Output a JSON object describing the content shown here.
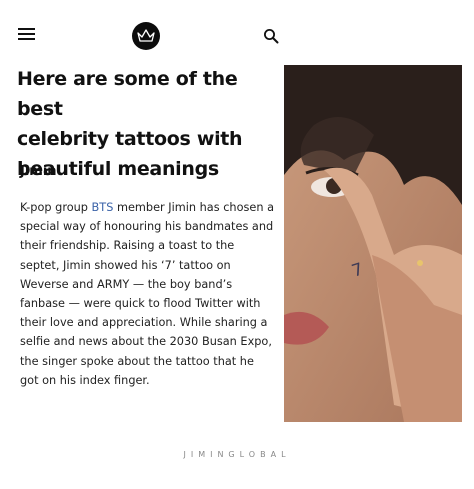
{
  "header": {
    "menu_icon": "hamburger-menu-icon",
    "logo_icon": "crown-logo-icon",
    "search_icon": "search-icon"
  },
  "article": {
    "headline_lines": [
      "Here are some of the best",
      "celebrity tattoos with",
      "beautiful meanings"
    ],
    "section_label": "Jimin",
    "body": {
      "before_link": "K-pop group ",
      "link_text": "BTS",
      "after_link": " member Jimin has chosen a special way of honouring his bandmates and their friendship. Raising a toast to the septet, Jimin showed his ‘7’ tattoo on Weverse and ARMY — the boy band’s fanbase — were quick to flood Twitter with their love and appreciation. While sharing a selfie and news about the 2030 Busan Expo, the singer spoke about the tattoo that he got on his index finger."
    },
    "link_color": "#3b63a8"
  },
  "photo": {
    "tattoo_text": "7"
  },
  "watermark": "JIMINGLOBAL"
}
